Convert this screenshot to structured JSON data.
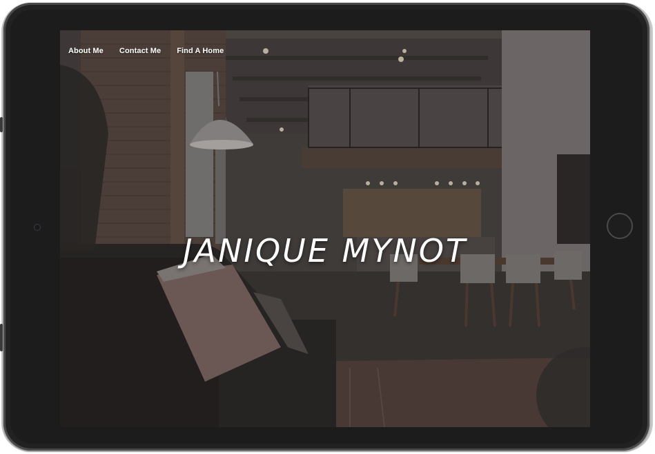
{
  "nav": {
    "items": [
      {
        "label": "About Me"
      },
      {
        "label": "Contact Me"
      },
      {
        "label": "Find A Home"
      }
    ]
  },
  "hero": {
    "title": "JANIQUE MYNOT",
    "background_description_icon": "loft-interior-photo"
  },
  "colors": {
    "device_frame": "#222222",
    "text": "#ffffff"
  }
}
